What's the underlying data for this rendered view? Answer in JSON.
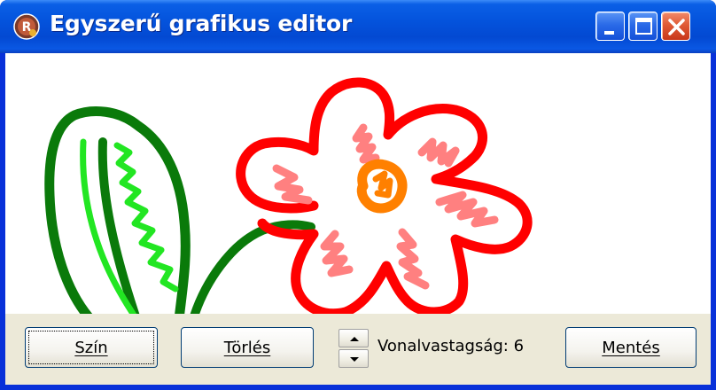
{
  "window": {
    "title": "Egyszerű grafikus editor"
  },
  "titlebar_buttons": [
    {
      "icon": "minimize-icon"
    },
    {
      "icon": "maximize-icon"
    },
    {
      "icon": "close-icon"
    }
  ],
  "toolbar": {
    "color_label": "Szín",
    "clear_label": "Törlés",
    "thickness_text": "Vonalvastagság: 6",
    "save_label": "Mentés"
  },
  "canvas": {
    "colors": {
      "dark_green": "#0a7a0a",
      "light_green": "#22e622",
      "red": "#ff0000",
      "pink": "#ff8080",
      "orange": "#ff8000"
    }
  },
  "colors": {
    "titlebar": "#0453dc",
    "close_button": "#e05a35",
    "toolbar_bg": "#ece9d8"
  }
}
